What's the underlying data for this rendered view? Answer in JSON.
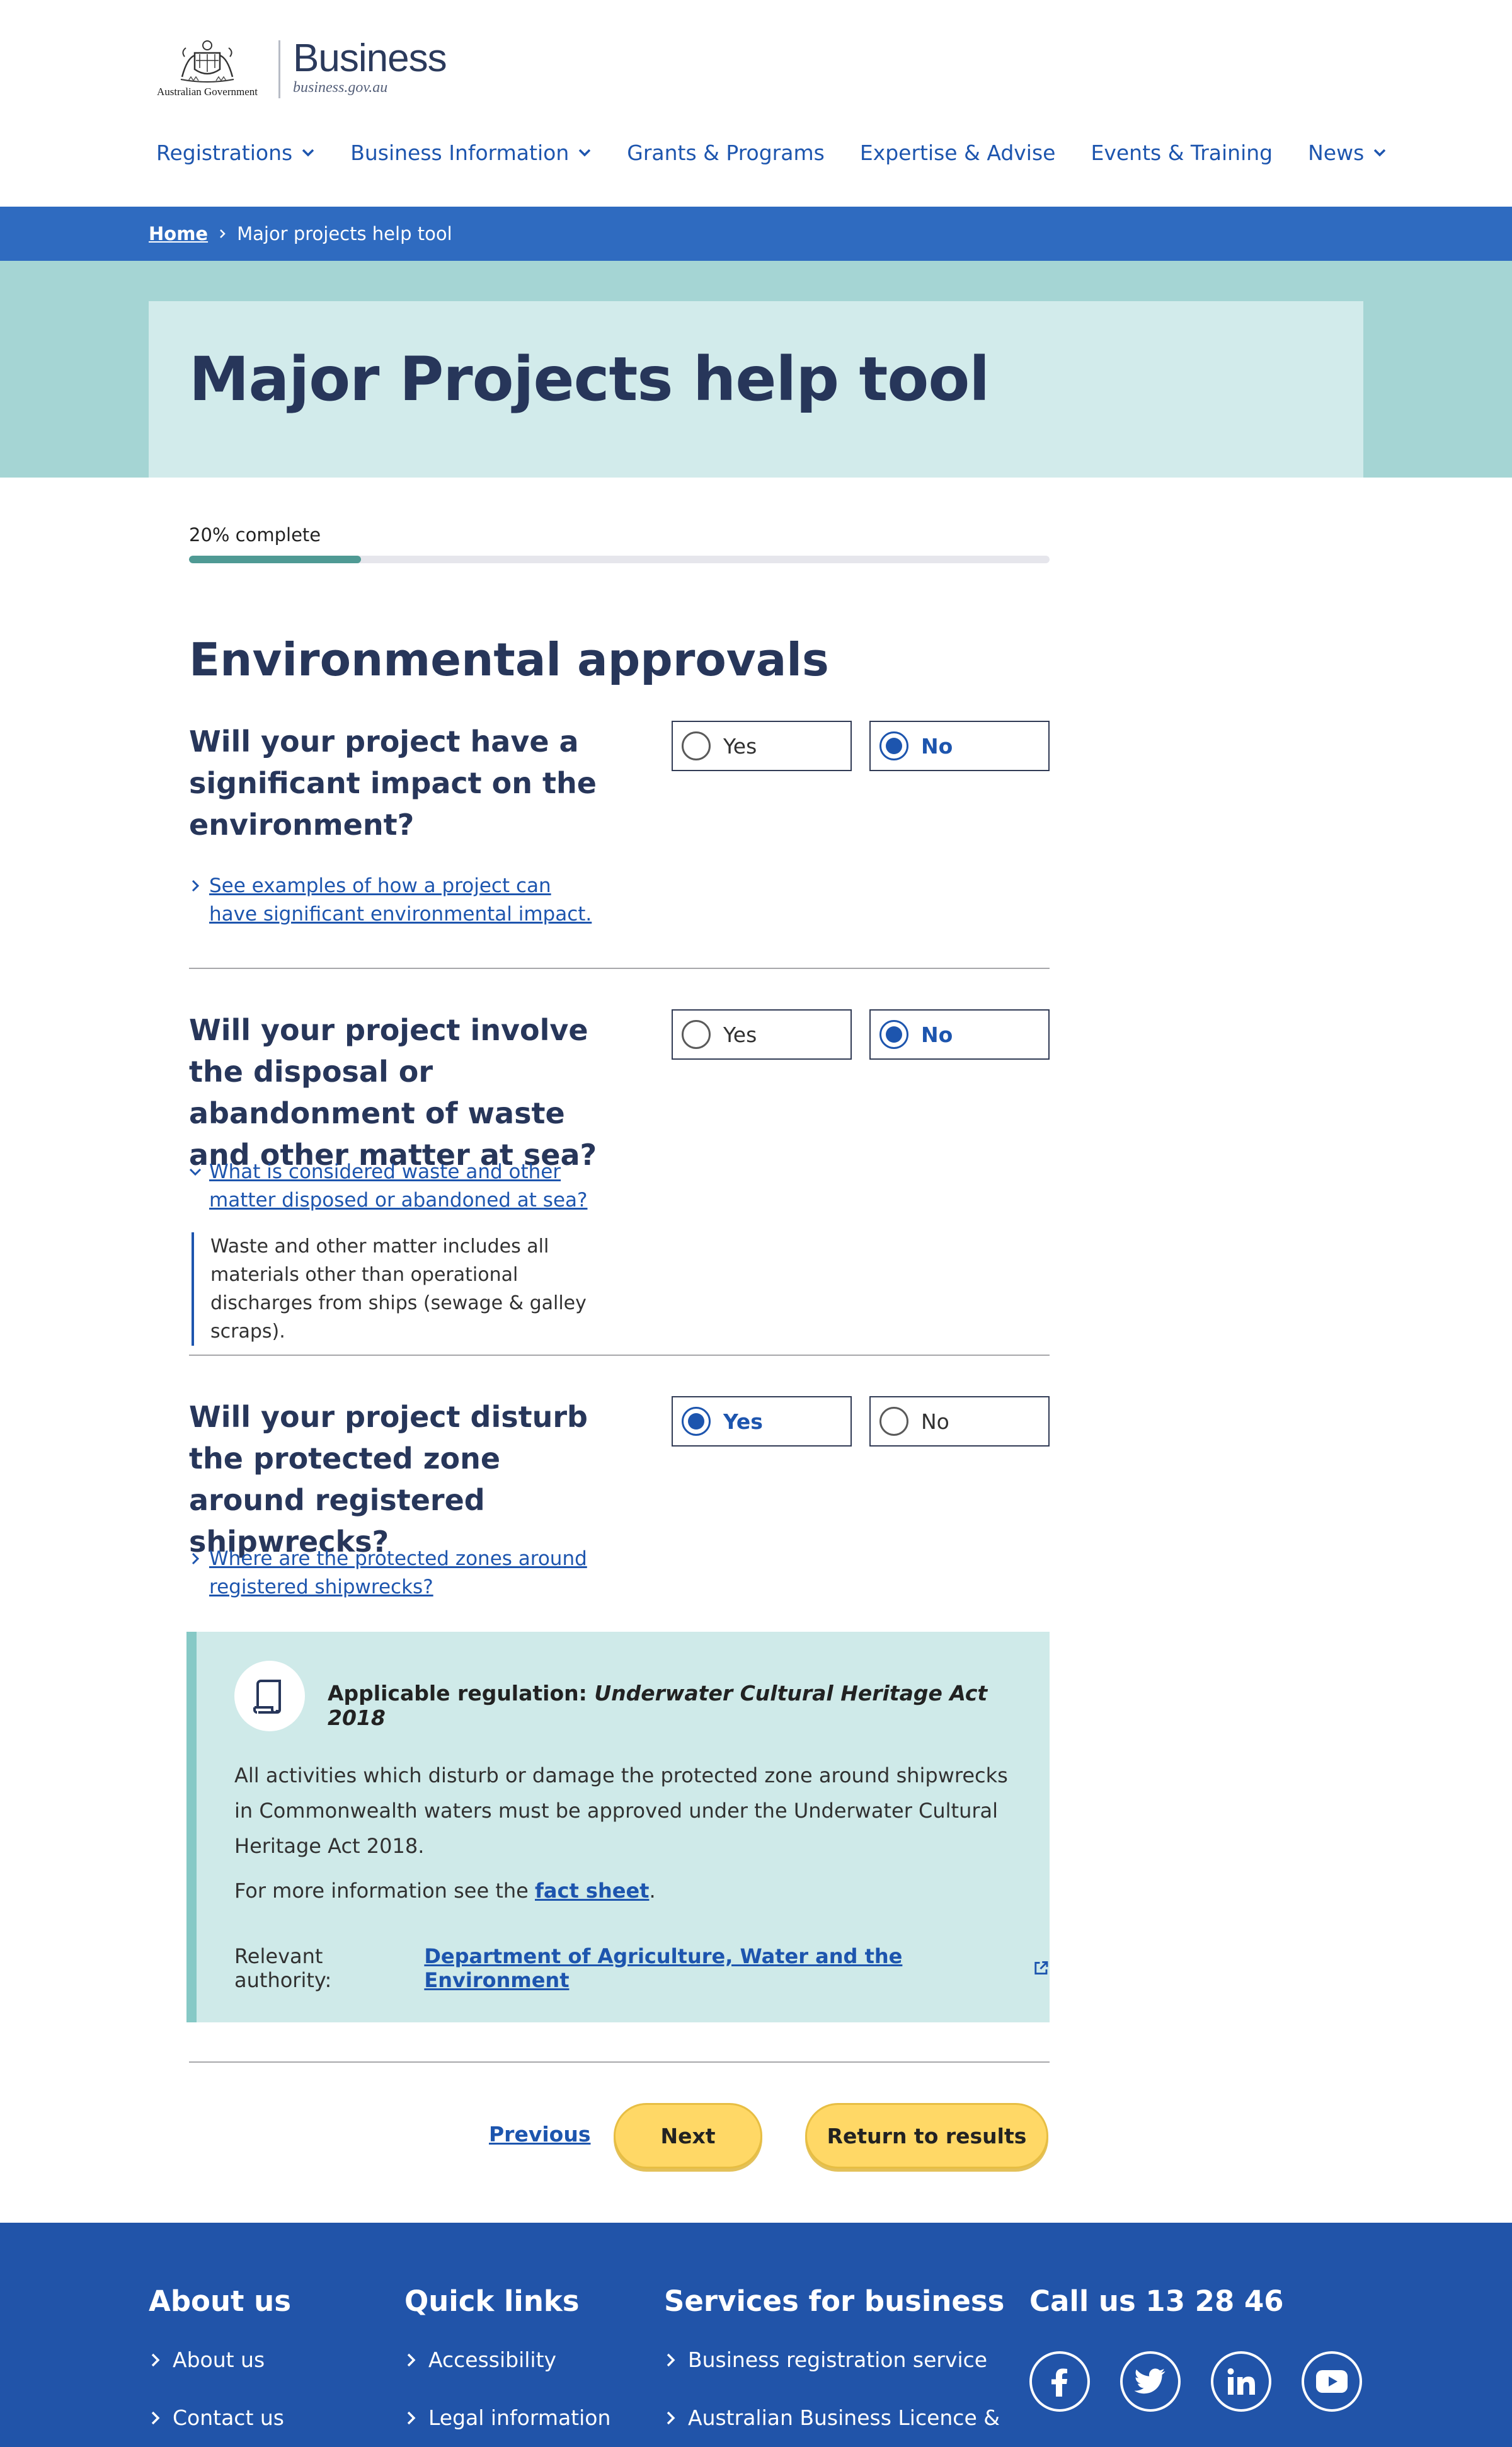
{
  "header": {
    "government_label": "Australian Government",
    "brand_name": "Business",
    "brand_url": "business.gov.au"
  },
  "nav": {
    "items": [
      {
        "label": "Registrations",
        "has_dropdown": true
      },
      {
        "label": "Business Information",
        "has_dropdown": true
      },
      {
        "label": "Grants & Programs",
        "has_dropdown": false
      },
      {
        "label": "Expertise & Advise",
        "has_dropdown": false
      },
      {
        "label": "Events & Training",
        "has_dropdown": false
      },
      {
        "label": "News",
        "has_dropdown": true
      }
    ]
  },
  "breadcrumb": {
    "home": "Home",
    "current": "Major projects help tool"
  },
  "page_title": "Major Projects help tool",
  "progress": {
    "label": "20% complete",
    "percent": 20
  },
  "section_title": "Environmental approvals",
  "questions": [
    {
      "text": "Will your project have a significant impact on the environment?",
      "link": "See examples of how a project can have significant environmental impact.",
      "options": [
        "Yes",
        "No"
      ],
      "selected": "No",
      "expanded": false
    },
    {
      "text": "Will your project involve the disposal or abandonment of waste and other matter at sea?",
      "link": "What is considered waste and other matter disposed or abandoned at sea?",
      "expanded_text": "Waste and other matter includes all materials other than operational discharges from ships (sewage & galley scraps).",
      "options": [
        "Yes",
        "No"
      ],
      "selected": "No",
      "expanded": true
    },
    {
      "text": "Will your project disturb the protected zone around registered shipwrecks?",
      "link": "Where are the protected zones around registered shipwrecks?",
      "options": [
        "Yes",
        "No"
      ],
      "selected": "Yes",
      "expanded": false
    }
  ],
  "regulation": {
    "label": "Applicable regulation:",
    "act": "Underwater Cultural Heritage Act 2018",
    "body": "All activities which disturb or damage the protected zone around shipwrecks in Commonwealth waters must be approved under the Underwater Cultural Heritage Act 2018.",
    "more_prefix": "For more information see the",
    "more_link": "fact sheet",
    "more_suffix": ".",
    "authority_prefix": "Relevant authority:",
    "authority_link": "Department of Agriculture, Water and the Environment"
  },
  "actions": {
    "previous": "Previous",
    "next": "Next",
    "return": "Return to results"
  },
  "footer": {
    "about_title": "About us",
    "about_links": [
      "About us",
      "Contact us"
    ],
    "quick_title": "Quick links",
    "quick_links": [
      "Accessibility",
      "Legal information"
    ],
    "services_title": "Services for business",
    "services_links": [
      "Business registration service",
      "Australian Business Licence &"
    ],
    "call_title": "Call us 13 28 46",
    "social": [
      "facebook-icon",
      "twitter-icon",
      "linkedin-icon",
      "youtube-icon"
    ]
  },
  "colors": {
    "primary_blue": "#1d55ae",
    "breadcrumb_bar": "#2f6bc0",
    "hero_bg": "#a5d5d4",
    "hero_card": "#d2ebeb",
    "button_yellow": "#ffd866",
    "footer_bg": "#2154a9",
    "progress_fill": "#4f9a94"
  }
}
